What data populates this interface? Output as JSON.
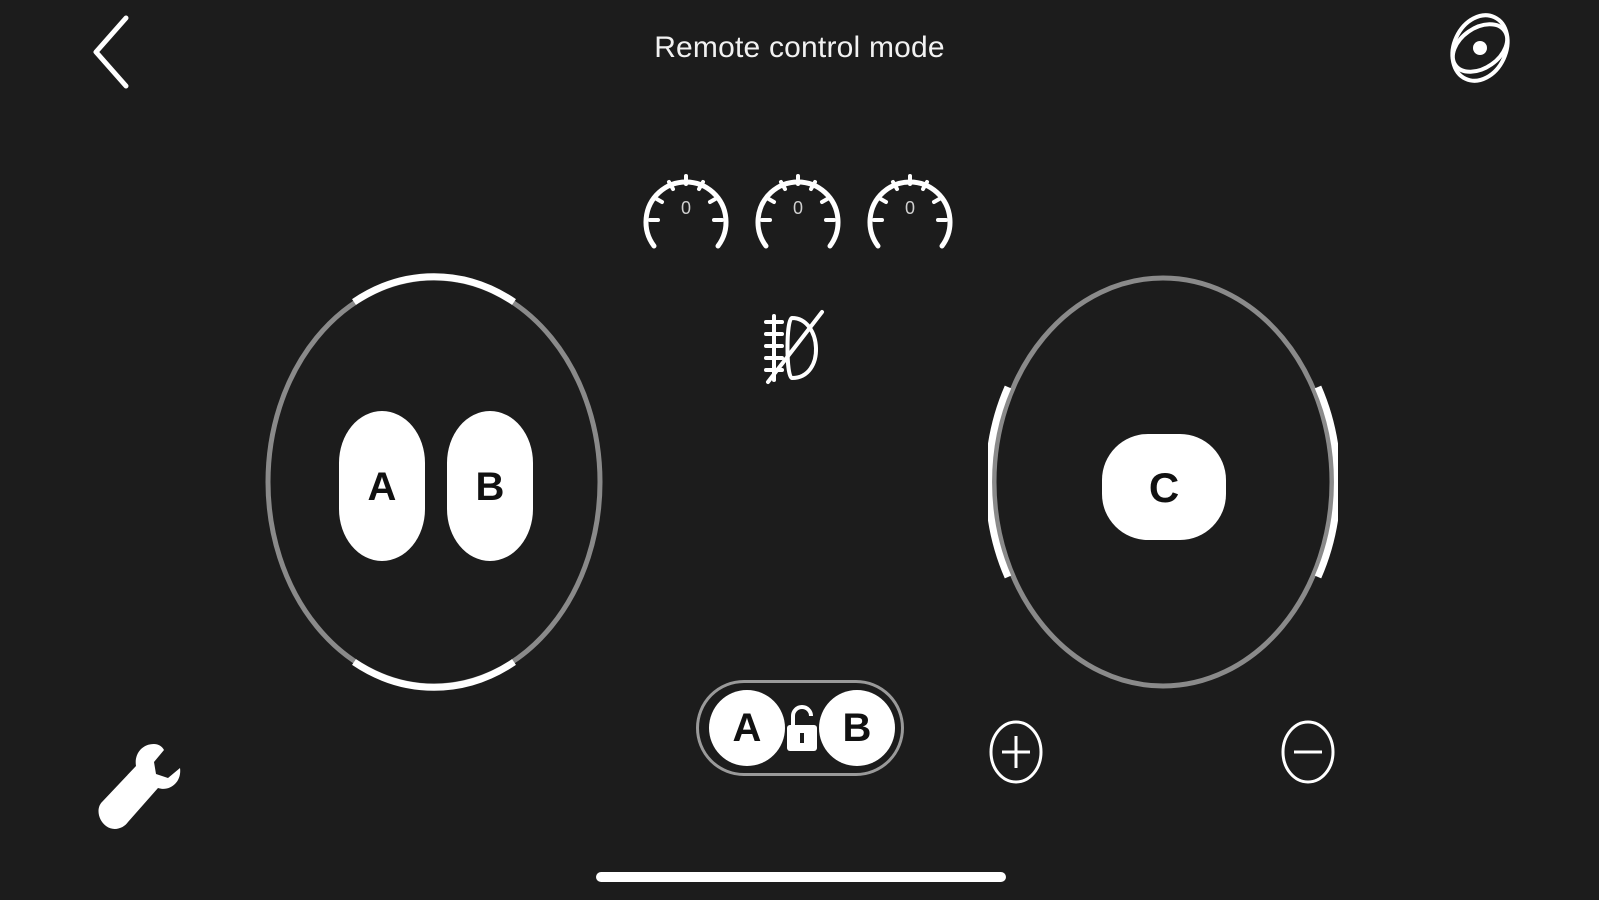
{
  "header": {
    "title": "Remote control mode",
    "back_icon": "chevron-left-icon",
    "right_icon": "orbit-icon"
  },
  "gauges": [
    {
      "value": "0",
      "icon": "speedometer-icon"
    },
    {
      "value": "0",
      "icon": "speedometer-icon"
    },
    {
      "value": "0",
      "icon": "speedometer-icon"
    }
  ],
  "center": {
    "fog_light_icon": "fog-light-off-icon"
  },
  "left_pad": {
    "button_a": "A",
    "button_b": "B"
  },
  "right_pad": {
    "button_c": "C"
  },
  "bottom": {
    "lock_a": "A",
    "lock_b": "B",
    "lock_icon": "unlock-icon",
    "plus_icon": "plus-circle-icon",
    "minus_icon": "minus-circle-icon",
    "wrench_icon": "wrench-icon"
  },
  "colors": {
    "background": "#1c1c1c",
    "foreground": "#ffffff",
    "ring_track": "#8a8a8a"
  }
}
